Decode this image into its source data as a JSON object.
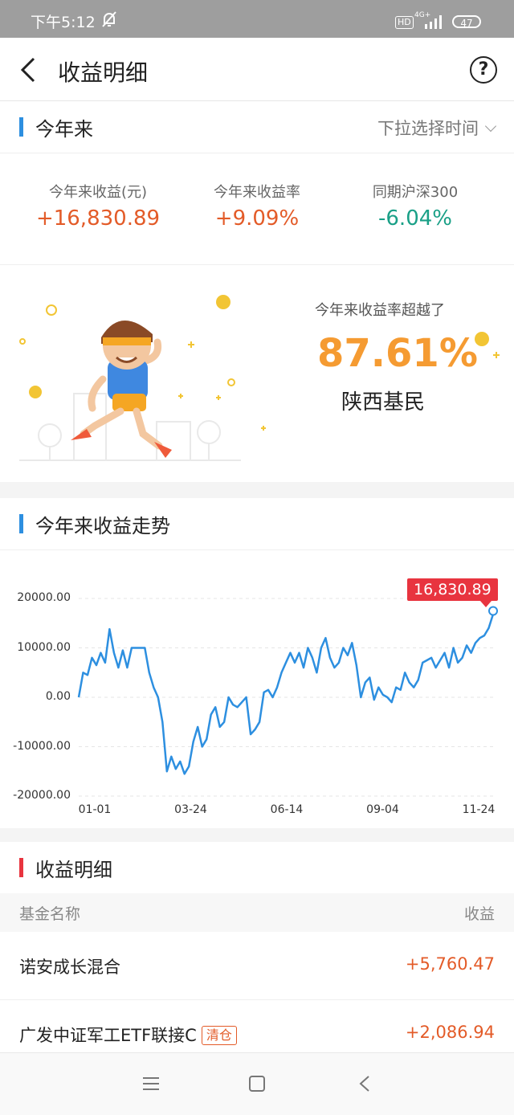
{
  "status_bar": {
    "time": "下午5:12",
    "hd": "HD",
    "network": "4G+",
    "battery": "47"
  },
  "header": {
    "title": "收益明细"
  },
  "ytd": {
    "section_title": "今年来",
    "time_selector": "下拉选择时间",
    "stats": [
      {
        "label": "今年来收益(元)",
        "value": "+16,830.89"
      },
      {
        "label": "今年来收益率",
        "value": "+9.09%"
      },
      {
        "label": "同期沪深300",
        "value": "-6.04%"
      }
    ]
  },
  "promo": {
    "line1": "今年来收益率超越了",
    "percent": "87.61%",
    "line3": "陕西基民"
  },
  "trend": {
    "section_title": "今年来收益走势",
    "tooltip": "16,830.89"
  },
  "colors": {
    "accent": "#2d8fe0",
    "positive": "#e35b28",
    "negative": "#1aa087",
    "highlight": "#f59b32",
    "tooltip": "#e8343f"
  },
  "chart_data": {
    "type": "line",
    "ylim": [
      -20000,
      20000
    ],
    "yticks": [
      "20000.00",
      "10000.00",
      "0.00",
      "-10000.00",
      "-20000.00"
    ],
    "xticks": [
      "01-01",
      "03-24",
      "06-14",
      "09-04",
      "11-24"
    ],
    "grid": true,
    "series": [
      {
        "values": [
          0,
          5000,
          4500,
          8000,
          6500,
          9000,
          7000,
          13800,
          9000,
          6000,
          9500,
          6000,
          10000,
          10000,
          10000,
          10000,
          5000,
          2000,
          0,
          -5000,
          -15000,
          -12000,
          -14500,
          -13000,
          -15500,
          -14000,
          -9000,
          -6000,
          -10000,
          -8500,
          -3500,
          -2000,
          -6000,
          -5000,
          0,
          -1500,
          -2000,
          -1000,
          0,
          -7500,
          -6500,
          -5000,
          1000,
          1500,
          0,
          2000,
          5000,
          7000,
          9000,
          7000,
          9000,
          6000,
          10000,
          8000,
          5000,
          10000,
          12000,
          8000,
          6000,
          7000,
          10000,
          8500,
          11000,
          6500,
          0,
          3000,
          4000,
          -500,
          2000,
          500,
          0,
          -1000,
          2000,
          1500,
          5000,
          3000,
          2000,
          3500,
          7000,
          7500,
          8000,
          6000,
          7500,
          9000,
          6000,
          10000,
          7000,
          8000,
          10500,
          9000,
          11000,
          12000,
          12500,
          14000,
          16830.89
        ]
      }
    ]
  },
  "detail": {
    "section_title": "收益明细",
    "col_name": "基金名称",
    "col_value": "收益",
    "rows": [
      {
        "name": "诺安成长混合",
        "value": "+5,760.47",
        "badge": ""
      },
      {
        "name": "广发中证军工ETF联接C",
        "value": "+2,086.94",
        "badge": "清仓"
      }
    ]
  }
}
